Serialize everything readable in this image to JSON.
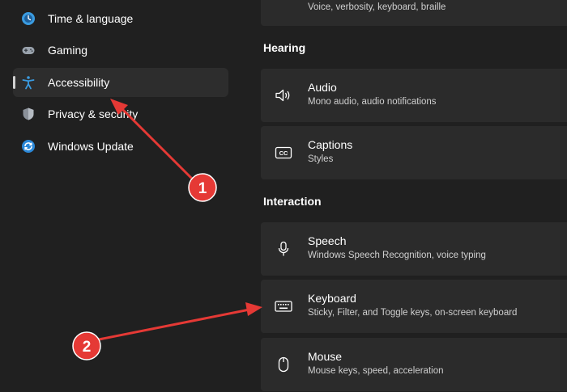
{
  "sidebar": {
    "items": [
      {
        "label": "Time & language"
      },
      {
        "label": "Gaming"
      },
      {
        "label": "Accessibility"
      },
      {
        "label": "Privacy & security"
      },
      {
        "label": "Windows Update"
      }
    ]
  },
  "main": {
    "top_card": {
      "desc": "Voice, verbosity, keyboard, braille"
    },
    "sections": [
      {
        "title": "Hearing",
        "cards": [
          {
            "title": "Audio",
            "desc": "Mono audio, audio notifications"
          },
          {
            "title": "Captions",
            "desc": "Styles"
          }
        ]
      },
      {
        "title": "Interaction",
        "cards": [
          {
            "title": "Speech",
            "desc": "Windows Speech Recognition, voice typing"
          },
          {
            "title": "Keyboard",
            "desc": "Sticky, Filter, and Toggle keys, on-screen keyboard"
          },
          {
            "title": "Mouse",
            "desc": "Mouse keys, speed, acceleration"
          }
        ]
      }
    ]
  },
  "annotations": {
    "markers": [
      {
        "label": "1"
      },
      {
        "label": "2"
      }
    ],
    "color": "#e53935"
  }
}
